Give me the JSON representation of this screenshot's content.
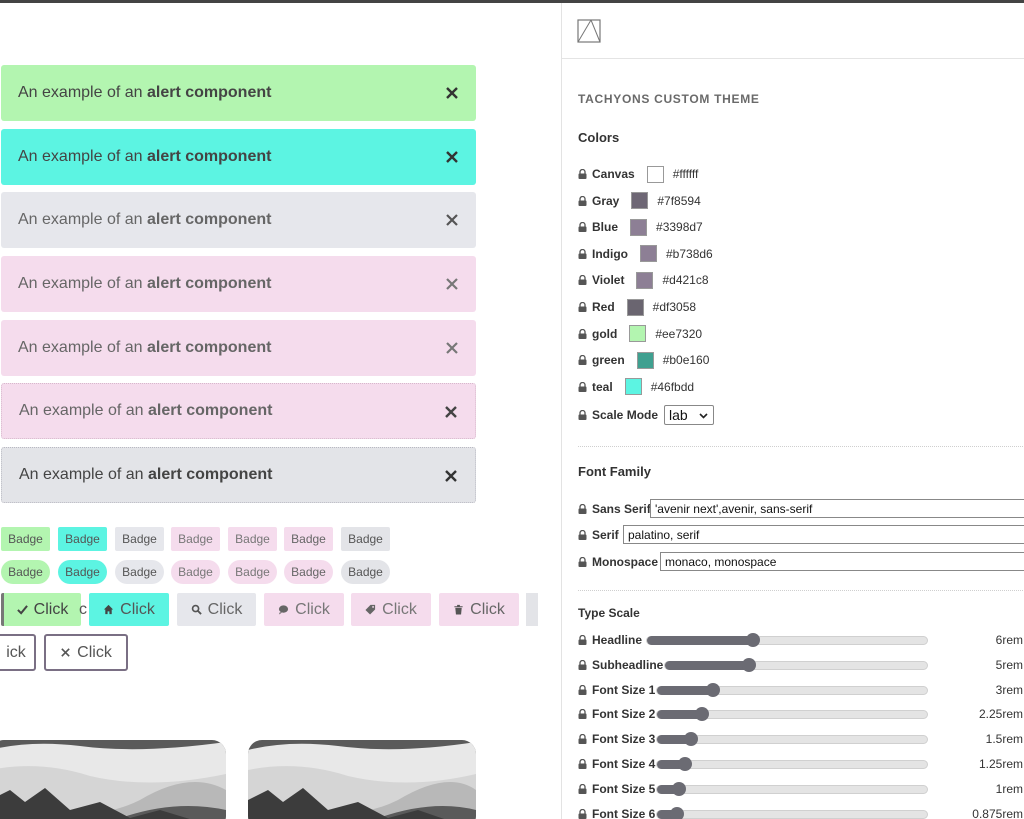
{
  "colors": {
    "alert_green": "#b3f5b0",
    "alert_teal": "#5cf4e2",
    "alert_gray": "#e6e7ec",
    "alert_pink": "#f5dced",
    "panel_accent": "#6b6b73"
  },
  "alerts": [
    {
      "prefix": "An example of an ",
      "strong": "alert component",
      "close": "✕"
    },
    {
      "prefix": "An example of an ",
      "strong": "alert component",
      "close": "✕"
    },
    {
      "prefix": "An example of an ",
      "strong": "alert component",
      "close": "✕"
    },
    {
      "prefix": "An example of an ",
      "strong": "alert component",
      "close": "✕"
    },
    {
      "prefix": "An example of an ",
      "strong": "alert component",
      "close": "✕"
    },
    {
      "prefix": "An example of an ",
      "strong": "alert component",
      "close": "✕"
    },
    {
      "prefix": "An example of an ",
      "strong": "alert component",
      "close": "✕"
    }
  ],
  "badges": {
    "square": [
      "Badge",
      "Badge",
      "Badge",
      "Badge",
      "Badge",
      "Badge",
      "Badge"
    ],
    "pill": [
      "Badge",
      "Badge",
      "Badge",
      "Badge",
      "Badge",
      "Badge",
      "Badge"
    ]
  },
  "buttons": {
    "row1": [
      {
        "label": "Click",
        "icon": "check-icon"
      },
      {
        "label": "Click",
        "icon": "home-icon"
      },
      {
        "label": "Click",
        "icon": "search-icon"
      },
      {
        "label": "Click",
        "icon": "comment-icon"
      },
      {
        "label": "Click",
        "icon": "tag-icon"
      },
      {
        "label": "Click",
        "icon": "trash-icon"
      }
    ],
    "row1_partial": "c",
    "row2_partial": "ick",
    "row2_close": {
      "label": "Click",
      "icon": "close-icon"
    }
  },
  "panel": {
    "title": "TACHYONS CUSTOM THEME",
    "colors_heading": "Colors",
    "colors": [
      {
        "label": "Canvas",
        "hex": "#ffffff",
        "swatch": "#ffffff"
      },
      {
        "label": "Gray",
        "hex": "#7f8594",
        "swatch": "#6e6775"
      },
      {
        "label": "Blue",
        "hex": "#3398d7",
        "swatch": "#8d7f95"
      },
      {
        "label": "Indigo",
        "hex": "#b738d6",
        "swatch": "#8d7f95"
      },
      {
        "label": "Violet",
        "hex": "#d421c8",
        "swatch": "#8d7f95"
      },
      {
        "label": "Red",
        "hex": "#df3058",
        "swatch": "#6a6570"
      },
      {
        "label": "gold",
        "hex": "#ee7320",
        "swatch": "#b3f5b0"
      },
      {
        "label": "green",
        "hex": "#b0e160",
        "swatch": "#3fa090"
      },
      {
        "label": "teal",
        "hex": "#46fbdd",
        "swatch": "#5cf4e2"
      }
    ],
    "scale_mode_label": "Scale Mode",
    "scale_mode_value": "lab",
    "font_family_heading": "Font Family",
    "fonts": [
      {
        "label": "Sans Serif",
        "value": "'avenir next',avenir, sans-serif"
      },
      {
        "label": "Serif",
        "value": "palatino, serif"
      },
      {
        "label": "Monospace",
        "value": "monaco, monospace"
      }
    ],
    "type_scale_heading": "Type Scale",
    "type_scale": [
      {
        "label": "Headline",
        "value": "6rem",
        "level": 0.38
      },
      {
        "label": "Subheadline",
        "value": "5rem",
        "level": 0.3
      },
      {
        "label": "Font Size 1",
        "value": "3rem",
        "level": 0.2
      },
      {
        "label": "Font Size 2",
        "value": "2.25rem",
        "level": 0.16
      },
      {
        "label": "Font Size 3",
        "value": "1.5rem",
        "level": 0.12
      },
      {
        "label": "Font Size 4",
        "value": "1.25rem",
        "level": 0.1
      },
      {
        "label": "Font Size 5",
        "value": "1rem",
        "level": 0.08
      },
      {
        "label": "Font Size 6",
        "value": "0.875rem",
        "level": 0.07
      }
    ]
  }
}
